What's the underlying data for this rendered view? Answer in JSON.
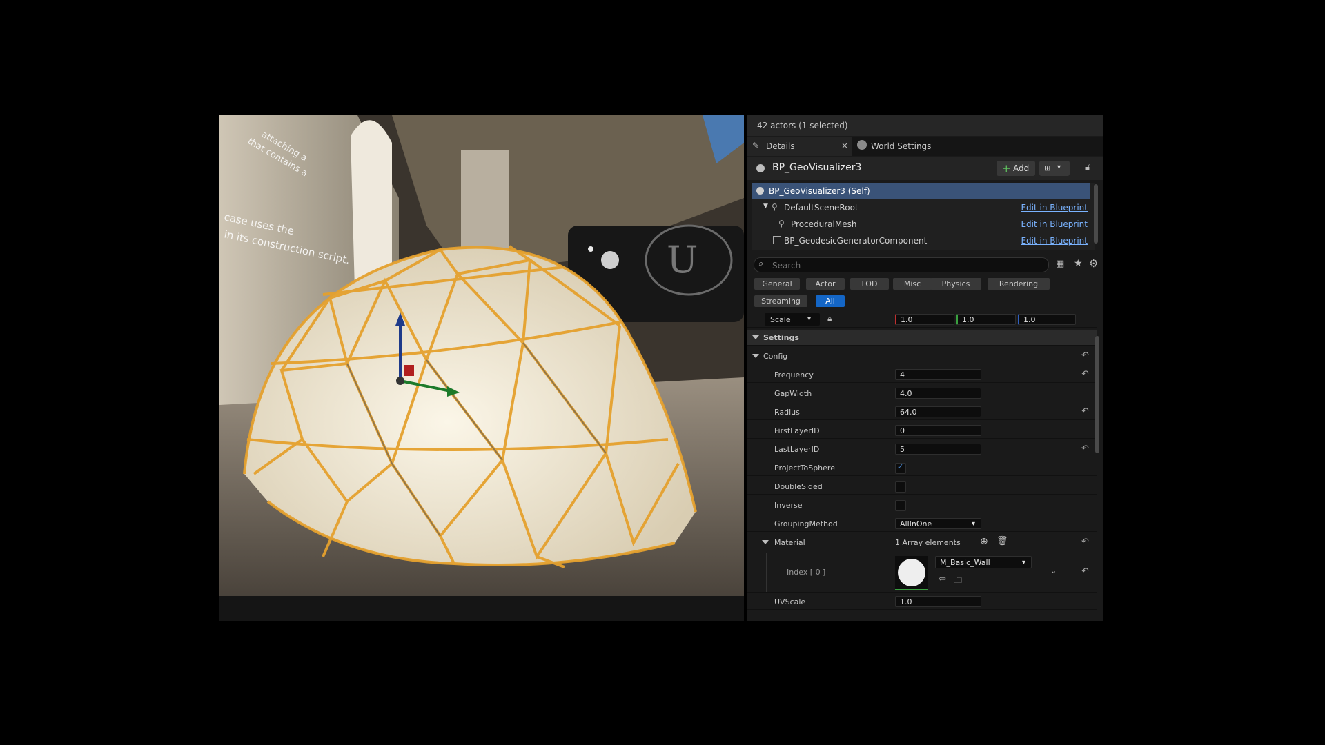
{
  "outliner": {
    "actor_count": "42 actors (1 selected)"
  },
  "tabs": [
    {
      "label": "Details",
      "close": "×"
    },
    {
      "label": "World Settings"
    }
  ],
  "actor": {
    "name": "BP_GeoVisualizer3",
    "add_label": "Add"
  },
  "components": [
    {
      "label": "BP_GeoVisualizer3 (Self)",
      "link": ""
    },
    {
      "label": "DefaultSceneRoot",
      "link": "Edit in Blueprint"
    },
    {
      "label": "ProceduralMesh",
      "link": "Edit in Blueprint"
    },
    {
      "label": "BP_GeodesicGeneratorComponent",
      "link": "Edit in Blueprint"
    }
  ],
  "search": {
    "placeholder": "Search"
  },
  "filters": [
    "General",
    "Actor",
    "LOD",
    "Misc",
    "Physics",
    "Rendering",
    "Streaming",
    "All"
  ],
  "active_filter": "All",
  "scale": {
    "mode": "Scale",
    "x": "1.0",
    "y": "1.0",
    "z": "1.0"
  },
  "sections": {
    "settings": "Settings",
    "config": "Config"
  },
  "properties": {
    "frequency": {
      "label": "Frequency",
      "value": "4"
    },
    "gapwidth": {
      "label": "GapWidth",
      "value": "4.0"
    },
    "radius": {
      "label": "Radius",
      "value": "64.0"
    },
    "firstlayer": {
      "label": "FirstLayerID",
      "value": "0"
    },
    "lastlayer": {
      "label": "LastLayerID",
      "value": "5"
    },
    "projecttosphere": {
      "label": "ProjectToSphere",
      "checked": true
    },
    "doublesided": {
      "label": "DoubleSided",
      "checked": false
    },
    "inverse": {
      "label": "Inverse",
      "checked": false
    },
    "grouping": {
      "label": "GroupingMethod",
      "value": "AllInOne"
    },
    "material": {
      "label": "Material",
      "count": "1 Array elements"
    },
    "index0": {
      "label": "Index [ 0 ]",
      "value": "M_Basic_Wall"
    },
    "uvscale": {
      "label": "UVScale",
      "value": "1.0"
    }
  },
  "viewport_text": {
    "line1": "case uses the",
    "line2": "in its construction script.",
    "line3": "attaching a",
    "line4": "that contains a"
  },
  "colors": {
    "accent": "#1466c6",
    "selection": "#3a5378",
    "dome_edge": "#e5a12e",
    "dome_face": "#f2ead6"
  }
}
